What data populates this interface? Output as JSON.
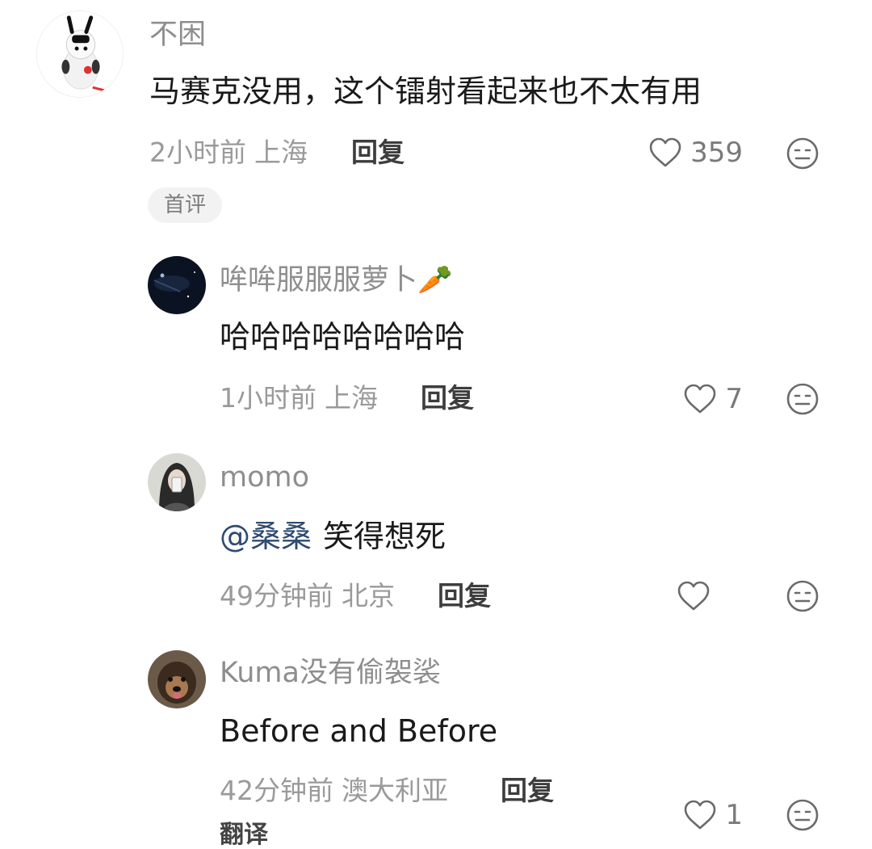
{
  "comments": [
    {
      "username": "不困",
      "text": "马赛克没用，这个镭射看起来也不太有用",
      "time": "2小时前",
      "location": "上海",
      "reply_label": "回复",
      "likes": "359",
      "badge": "首评"
    },
    {
      "username": "哞哞服服服萝卜🥕",
      "text": "哈哈哈哈哈哈哈哈",
      "time": "1小时前",
      "location": "上海",
      "reply_label": "回复",
      "likes": "7"
    },
    {
      "username": "momo",
      "mention": "@桑桑",
      "text": "笑得想死",
      "time": "49分钟前",
      "location": "北京",
      "reply_label": "回复",
      "likes": ""
    },
    {
      "username": "Kuma没有偷袈裟",
      "text": "Before and Before",
      "time": "42分钟前",
      "location": "澳大利亚",
      "reply_label": "回复",
      "likes": "1",
      "translate_label": "翻译"
    }
  ],
  "icons": {
    "like": "heart-outline-icon",
    "dislike": "meh-face-icon"
  },
  "colors": {
    "username": "#8e8e8e",
    "mention": "#2f4a70",
    "meta": "#9a9a9a"
  }
}
